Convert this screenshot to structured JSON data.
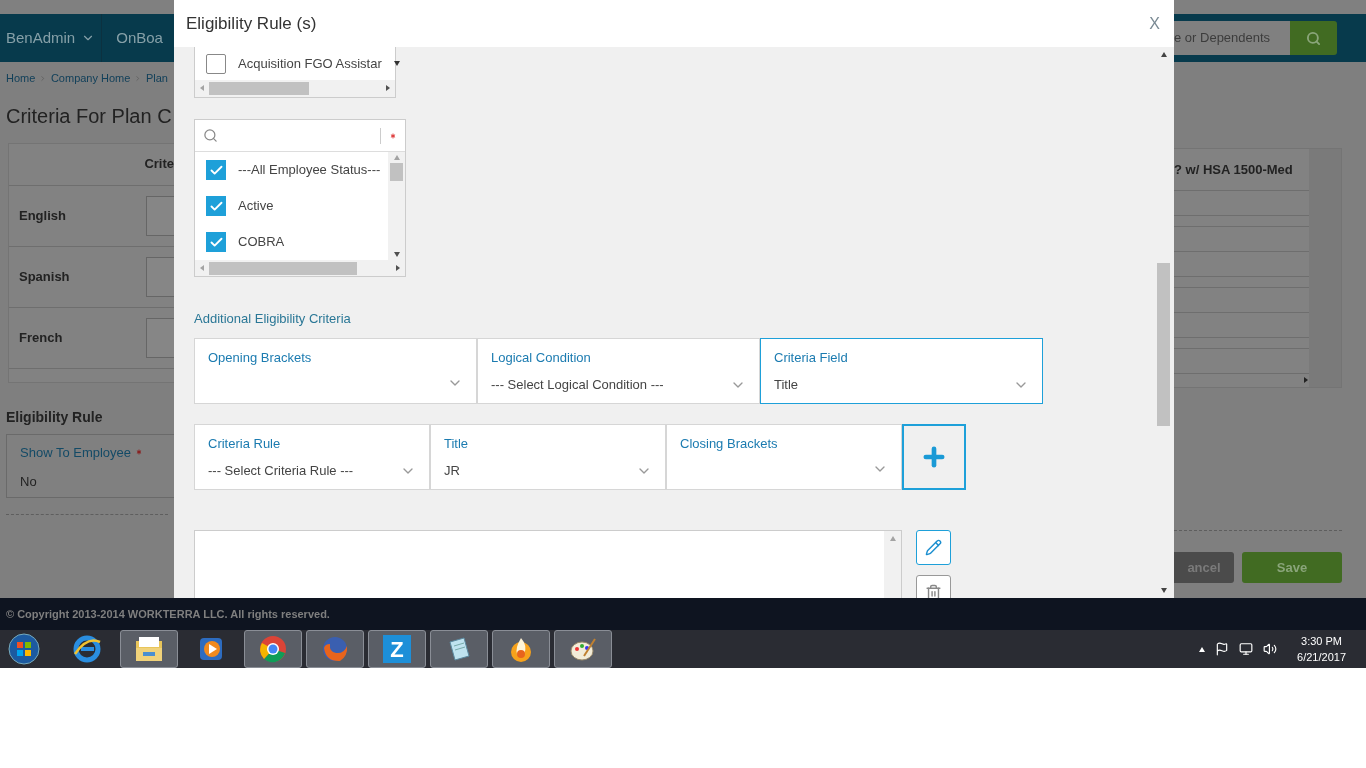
{
  "background": {
    "nav": {
      "menu": "BenAdmin",
      "menu_2": "OnBoa",
      "search_placeholder": "e or Dependents"
    },
    "breadcrumb": [
      "Home",
      "Company Home",
      "Plan"
    ],
    "title": "Criteria For Plan C",
    "table": {
      "column_header": "Crite",
      "column_header_right": "? w/ HSA 1500-Med",
      "rows": [
        "English",
        "Spanish",
        "French"
      ]
    },
    "eligibility": {
      "heading": "Eligibility Rule",
      "field_label": "Show To Employee",
      "required": true,
      "value": "No"
    },
    "buttons": [
      {
        "label": "ancel",
        "kind": "secondary"
      },
      {
        "label": "Save",
        "kind": "primary"
      }
    ]
  },
  "footer": "© Copyright 2013-2014 WORKTERRA LLC. All rights reserved.",
  "dialog": {
    "title": "Eligibility Rule (s)",
    "close": "X",
    "company_list": {
      "items": [
        {
          "label": "Acquisition FGO Assistar",
          "checked": false
        }
      ]
    },
    "status_list": {
      "required": true,
      "items": [
        {
          "label": "---All Employee Status---",
          "checked": true
        },
        {
          "label": "Active",
          "checked": true
        },
        {
          "label": "COBRA",
          "checked": true
        }
      ]
    },
    "section_title": "Additional Eligibility Criteria",
    "criteria_row_1": [
      {
        "label": "Opening Brackets",
        "focused": false
      },
      {
        "label": "Logical Condition",
        "value": "--- Select Logical Condition ---",
        "focused": false
      },
      {
        "label": "Criteria Field",
        "value": "Title",
        "focused": true
      }
    ],
    "criteria_row_2": [
      {
        "label": "Criteria Rule",
        "value": "--- Select Criteria Rule ---",
        "focused": false
      },
      {
        "label": "Title",
        "value": "JR",
        "focused": false
      },
      {
        "label": "Closing Brackets",
        "focused": false
      }
    ]
  },
  "taskbar": {
    "apps": [
      {
        "kind": "browser-e",
        "running": false
      },
      {
        "kind": "folder",
        "running": true
      },
      {
        "kind": "media",
        "running": false
      },
      {
        "kind": "chrome",
        "running": true
      },
      {
        "kind": "firefox",
        "running": true
      },
      {
        "kind": "letter",
        "label": "Z",
        "running": true
      },
      {
        "kind": "notepad",
        "running": true
      },
      {
        "kind": "flame",
        "running": true
      },
      {
        "kind": "paint",
        "running": true
      }
    ],
    "time": "3:30 PM",
    "date": "6/21/2017"
  }
}
